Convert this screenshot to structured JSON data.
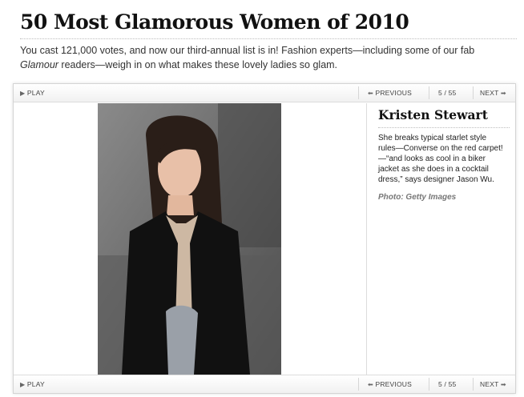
{
  "header": {
    "title": "50 Most Glamorous Women of 2010",
    "intro_part1": "You cast 121,000 votes, and now our third-annual list is in! Fashion experts—including some of our fab ",
    "intro_emphasis": "Glamour",
    "intro_part2": " readers—weigh in on what makes these lovely ladies so glam."
  },
  "controls": {
    "play_label": "PLAY",
    "previous_label": "PREVIOUS",
    "next_label": "NEXT",
    "counter": "5 / 55",
    "play_icon": "▶",
    "previous_icon": "⬅",
    "next_icon": "➡"
  },
  "slide": {
    "name": "Kristen Stewart",
    "blurb": "She breaks typical starlet style rules—Converse on the red carpet!—“and looks as cool in a biker jacket as she does in a cocktail dress,” says designer Jason Wu.",
    "credit": "Photo: Getty Images",
    "photo_icon": "celebrity-photo"
  },
  "colors": {
    "title": "#111111",
    "intro_text": "#333333",
    "credit": "#777777",
    "border": "#d4d4d4"
  }
}
